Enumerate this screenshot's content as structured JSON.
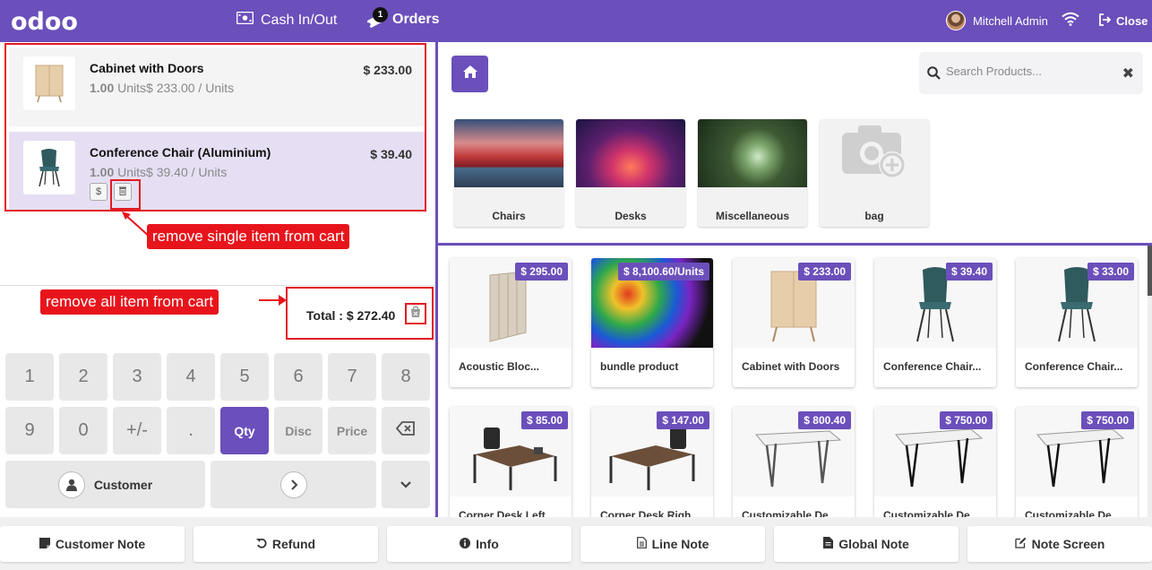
{
  "header": {
    "logo": "odoo",
    "cash_in_out": "Cash In/Out",
    "orders": "Orders",
    "orders_badge": "1",
    "user_name": "Mitchell Admin",
    "close": "Close",
    "color": "#6b4fbb"
  },
  "order_lines": [
    {
      "name": "Cabinet with Doors",
      "qty": "1.00",
      "unit_price": "Units$ 233.00 / Units",
      "price": "$ 233.00"
    },
    {
      "name": "Conference Chair (Aluminium)",
      "qty": "1.00",
      "unit_price": "Units$ 39.40 / Units",
      "price": "$ 39.40",
      "selected": true
    }
  ],
  "annotations": {
    "single": "remove  single item from cart",
    "all": "remove  all  item from cart",
    "color": "#e8141c"
  },
  "total": "Total : $ 272.40",
  "numpad": {
    "row1": [
      "1",
      "2",
      "3",
      "4",
      "5",
      "6",
      "7",
      "8"
    ],
    "row2": [
      "9",
      "0",
      "+/-",
      ".",
      "Qty",
      "Disc",
      "Price"
    ],
    "customer": "Customer"
  },
  "search": {
    "placeholder": "Search Products..."
  },
  "categories": [
    {
      "name": "Chairs"
    },
    {
      "name": "Desks"
    },
    {
      "name": "Miscellaneous"
    },
    {
      "name": "bag"
    }
  ],
  "products": [
    {
      "name": "Acoustic Bloc...",
      "price": "$ 295.00"
    },
    {
      "name": "bundle product",
      "price": "$ 8,100.60/Units"
    },
    {
      "name": "Cabinet with Doors",
      "price": "$ 233.00"
    },
    {
      "name": "Conference Chair...",
      "price": "$ 39.40"
    },
    {
      "name": "Conference Chair...",
      "price": "$ 33.00"
    },
    {
      "name": "Corner Desk Left...",
      "price": "$ 85.00"
    },
    {
      "name": "Corner Desk Righ...",
      "price": "$ 147.00"
    },
    {
      "name": "Customizable De...",
      "price": "$ 800.40"
    },
    {
      "name": "Customizable De...",
      "price": "$ 750.00"
    },
    {
      "name": "Customizable De...",
      "price": "$ 750.00"
    }
  ],
  "bottom": {
    "customer_note": "Customer Note",
    "refund": "Refund",
    "info": "Info",
    "line_note": "Line Note",
    "global_note": "Global Note",
    "note_screen": "Note Screen"
  }
}
